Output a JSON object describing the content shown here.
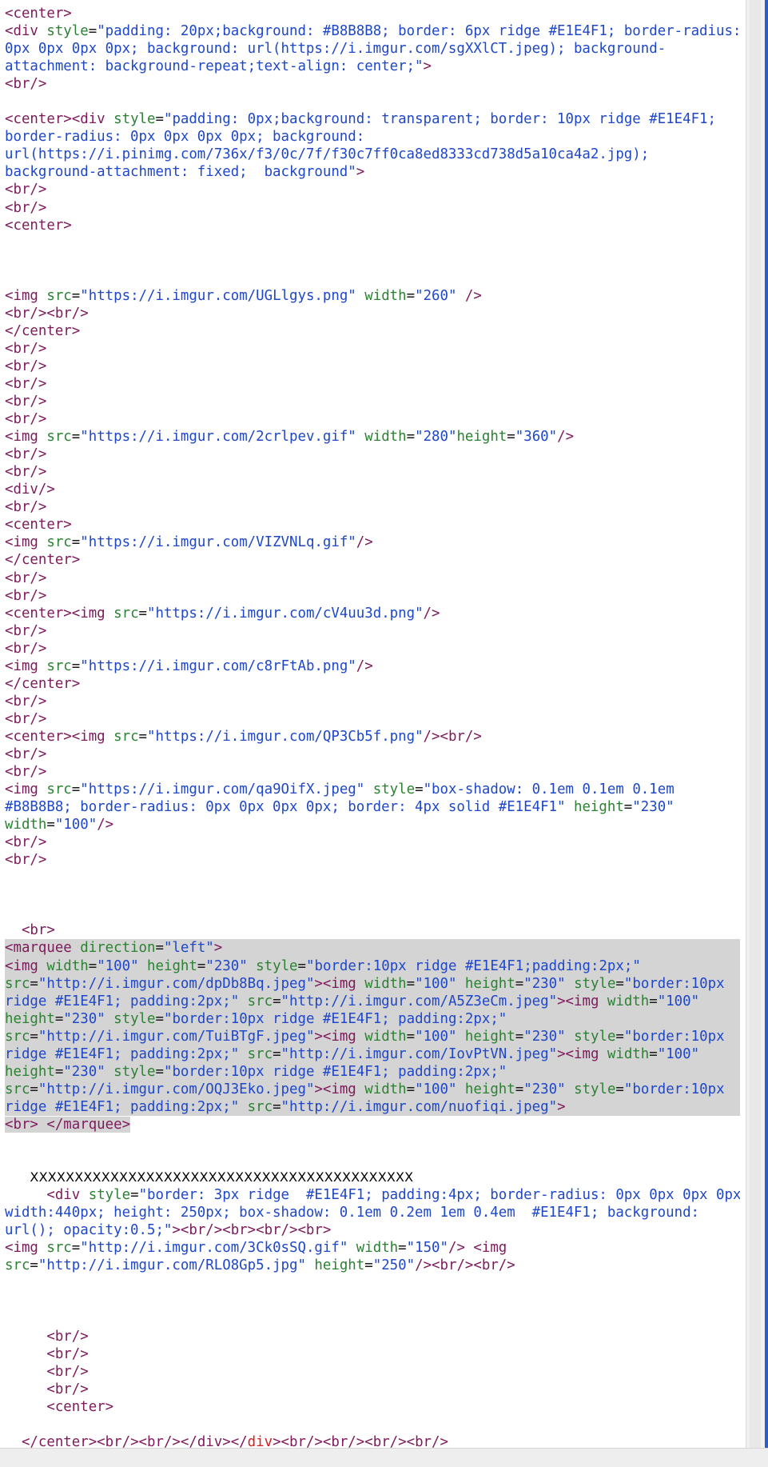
{
  "lines": [
    {
      "segs": [
        [
          "tag",
          "<center>"
        ]
      ]
    },
    {
      "segs": [
        [
          "tag",
          "<div "
        ],
        [
          "attr",
          "style"
        ],
        [
          "plain",
          "="
        ],
        [
          "val",
          "\"padding: 20px;background: #B8B8B8; border: 6px ridge #E1E4F1; border-radius:"
        ]
      ]
    },
    {
      "segs": [
        [
          "val",
          "0px 0px 0px 0px; background: url(https://i.imgur.com/sgXXlCT.jpeg); background-"
        ]
      ]
    },
    {
      "segs": [
        [
          "val",
          "attachment: background-repeat;text-align: center;\""
        ],
        [
          "tag",
          ">"
        ]
      ]
    },
    {
      "segs": [
        [
          "tag",
          "<br/>"
        ]
      ]
    },
    {
      "segs": []
    },
    {
      "segs": [
        [
          "tag",
          "<center><div "
        ],
        [
          "attr",
          "style"
        ],
        [
          "plain",
          "="
        ],
        [
          "val",
          "\"padding: 0px;background: transparent; border: 10px ridge #E1E4F1;"
        ]
      ]
    },
    {
      "segs": [
        [
          "val",
          "border-radius: 0px 0px 0px 0px; background:"
        ]
      ]
    },
    {
      "segs": [
        [
          "val",
          "url(https://i.pinimg.com/736x/f3/0c/7f/f30c7ff0ca8ed8333cd738d5a10ca4a2.jpg);"
        ]
      ]
    },
    {
      "segs": [
        [
          "val",
          "background-attachment: fixed;  background\""
        ],
        [
          "tag",
          ">"
        ]
      ]
    },
    {
      "segs": [
        [
          "tag",
          "<br/>"
        ]
      ]
    },
    {
      "segs": [
        [
          "tag",
          "<br/>"
        ]
      ]
    },
    {
      "segs": [
        [
          "tag",
          "<center>"
        ]
      ]
    },
    {
      "segs": []
    },
    {
      "segs": []
    },
    {
      "segs": []
    },
    {
      "segs": [
        [
          "tag",
          "<img "
        ],
        [
          "attr",
          "src"
        ],
        [
          "plain",
          "="
        ],
        [
          "val",
          "\"https://i.imgur.com/UGLlgys.png\" "
        ],
        [
          "attr",
          "width"
        ],
        [
          "plain",
          "="
        ],
        [
          "val",
          "\"260\" "
        ],
        [
          "tag",
          "/>"
        ]
      ]
    },
    {
      "segs": [
        [
          "tag",
          "<br/><br/>"
        ]
      ]
    },
    {
      "segs": [
        [
          "tag",
          "</center>"
        ]
      ]
    },
    {
      "segs": [
        [
          "tag",
          "<br/>"
        ]
      ]
    },
    {
      "segs": [
        [
          "tag",
          "<br/>"
        ]
      ]
    },
    {
      "segs": [
        [
          "tag",
          "<br/>"
        ]
      ]
    },
    {
      "segs": [
        [
          "tag",
          "<br/>"
        ]
      ]
    },
    {
      "segs": [
        [
          "tag",
          "<br/>"
        ]
      ]
    },
    {
      "segs": [
        [
          "tag",
          "<img "
        ],
        [
          "attr",
          "src"
        ],
        [
          "plain",
          "="
        ],
        [
          "val",
          "\"https://i.imgur.com/2crlpev.gif\" "
        ],
        [
          "attr",
          "width"
        ],
        [
          "plain",
          "="
        ],
        [
          "val",
          "\"280\""
        ],
        [
          "attr",
          "height"
        ],
        [
          "plain",
          "="
        ],
        [
          "val",
          "\"360\""
        ],
        [
          "tag",
          "/>"
        ]
      ]
    },
    {
      "segs": [
        [
          "tag",
          "<br/>"
        ]
      ]
    },
    {
      "segs": [
        [
          "tag",
          "<br/>"
        ]
      ]
    },
    {
      "segs": [
        [
          "tag",
          "<div/>"
        ]
      ]
    },
    {
      "segs": [
        [
          "tag",
          "<br/>"
        ]
      ]
    },
    {
      "segs": [
        [
          "tag",
          "<center>"
        ]
      ]
    },
    {
      "segs": [
        [
          "tag",
          "<img "
        ],
        [
          "attr",
          "src"
        ],
        [
          "plain",
          "="
        ],
        [
          "val",
          "\"https://i.imgur.com/VIZVNLq.gif\""
        ],
        [
          "tag",
          "/>"
        ]
      ]
    },
    {
      "segs": [
        [
          "tag",
          "</center>"
        ]
      ]
    },
    {
      "segs": [
        [
          "tag",
          "<br/>"
        ]
      ]
    },
    {
      "segs": [
        [
          "tag",
          "<br/>"
        ]
      ]
    },
    {
      "segs": [
        [
          "tag",
          "<center><img "
        ],
        [
          "attr",
          "src"
        ],
        [
          "plain",
          "="
        ],
        [
          "val",
          "\"https://i.imgur.com/cV4uu3d.png\""
        ],
        [
          "tag",
          "/>"
        ]
      ]
    },
    {
      "segs": [
        [
          "tag",
          "<br/>"
        ]
      ]
    },
    {
      "segs": [
        [
          "tag",
          "<br/>"
        ]
      ]
    },
    {
      "segs": [
        [
          "tag",
          "<img "
        ],
        [
          "attr",
          "src"
        ],
        [
          "plain",
          "="
        ],
        [
          "val",
          "\"https://i.imgur.com/c8rFtAb.png\""
        ],
        [
          "tag",
          "/>"
        ]
      ]
    },
    {
      "segs": [
        [
          "tag",
          "</center>"
        ]
      ]
    },
    {
      "segs": [
        [
          "tag",
          "<br/>"
        ]
      ]
    },
    {
      "segs": [
        [
          "tag",
          "<br/>"
        ]
      ]
    },
    {
      "segs": [
        [
          "tag",
          "<center><img "
        ],
        [
          "attr",
          "src"
        ],
        [
          "plain",
          "="
        ],
        [
          "val",
          "\"https://i.imgur.com/QP3Cb5f.png\""
        ],
        [
          "tag",
          "/><br/>"
        ]
      ]
    },
    {
      "segs": [
        [
          "tag",
          "<br/>"
        ]
      ]
    },
    {
      "segs": [
        [
          "tag",
          "<br/>"
        ]
      ]
    },
    {
      "segs": [
        [
          "tag",
          "<img "
        ],
        [
          "attr",
          "src"
        ],
        [
          "plain",
          "="
        ],
        [
          "val",
          "\"https://i.imgur.com/qa9OifX.jpeg\" "
        ],
        [
          "attr",
          "style"
        ],
        [
          "plain",
          "="
        ],
        [
          "val",
          "\"box-shadow: 0.1em 0.1em 0.1em"
        ]
      ]
    },
    {
      "segs": [
        [
          "val",
          "#B8B8B8; border-radius: 0px 0px 0px 0px; border: 4px solid #E1E4F1\" "
        ],
        [
          "attr",
          "height"
        ],
        [
          "plain",
          "="
        ],
        [
          "val",
          "\"230\""
        ]
      ]
    },
    {
      "segs": [
        [
          "attr",
          "width"
        ],
        [
          "plain",
          "="
        ],
        [
          "val",
          "\"100\""
        ],
        [
          "tag",
          "/>"
        ]
      ]
    },
    {
      "segs": [
        [
          "tag",
          "<br/>"
        ]
      ]
    },
    {
      "segs": [
        [
          "tag",
          "<br/>"
        ]
      ]
    },
    {
      "segs": []
    },
    {
      "segs": []
    },
    {
      "segs": []
    },
    {
      "segs": [
        [
          "plain",
          "  "
        ],
        [
          "tag",
          "<br>"
        ]
      ]
    },
    {
      "sel": true,
      "segs": [
        [
          "tag",
          "<marquee "
        ],
        [
          "attr",
          "direction"
        ],
        [
          "plain",
          "="
        ],
        [
          "val",
          "\"left\""
        ],
        [
          "tag",
          ">"
        ]
      ]
    },
    {
      "sel": true,
      "segs": [
        [
          "tag",
          "<img "
        ],
        [
          "attr",
          "width"
        ],
        [
          "plain",
          "="
        ],
        [
          "val",
          "\"100\" "
        ],
        [
          "attr",
          "height"
        ],
        [
          "plain",
          "="
        ],
        [
          "val",
          "\"230\" "
        ],
        [
          "attr",
          "style"
        ],
        [
          "plain",
          "="
        ],
        [
          "val",
          "\"border:10px ridge #E1E4F1;padding:2px;\""
        ]
      ]
    },
    {
      "sel": true,
      "segs": [
        [
          "attr",
          "src"
        ],
        [
          "plain",
          "="
        ],
        [
          "val",
          "\"http://i.imgur.com/dpDb8Bq.jpeg\""
        ],
        [
          "tag",
          "><img "
        ],
        [
          "attr",
          "width"
        ],
        [
          "plain",
          "="
        ],
        [
          "val",
          "\"100\" "
        ],
        [
          "attr",
          "height"
        ],
        [
          "plain",
          "="
        ],
        [
          "val",
          "\"230\" "
        ],
        [
          "attr",
          "style"
        ],
        [
          "plain",
          "="
        ],
        [
          "val",
          "\"border:10px"
        ]
      ]
    },
    {
      "sel": true,
      "segs": [
        [
          "val",
          "ridge #E1E4F1; padding:2px;\" "
        ],
        [
          "attr",
          "src"
        ],
        [
          "plain",
          "="
        ],
        [
          "val",
          "\"http://i.imgur.com/A5Z3eCm.jpeg\""
        ],
        [
          "tag",
          "><img "
        ],
        [
          "attr",
          "width"
        ],
        [
          "plain",
          "="
        ],
        [
          "val",
          "\"100\""
        ]
      ]
    },
    {
      "sel": true,
      "segs": [
        [
          "attr",
          "height"
        ],
        [
          "plain",
          "="
        ],
        [
          "val",
          "\"230\" "
        ],
        [
          "attr",
          "style"
        ],
        [
          "plain",
          "="
        ],
        [
          "val",
          "\"border:10px ridge #E1E4F1; padding:2px;\""
        ]
      ]
    },
    {
      "sel": true,
      "segs": [
        [
          "attr",
          "src"
        ],
        [
          "plain",
          "="
        ],
        [
          "val",
          "\"http://i.imgur.com/TuiBTgF.jpeg\""
        ],
        [
          "tag",
          "><img "
        ],
        [
          "attr",
          "width"
        ],
        [
          "plain",
          "="
        ],
        [
          "val",
          "\"100\" "
        ],
        [
          "attr",
          "height"
        ],
        [
          "plain",
          "="
        ],
        [
          "val",
          "\"230\" "
        ],
        [
          "attr",
          "style"
        ],
        [
          "plain",
          "="
        ],
        [
          "val",
          "\"border:10px"
        ]
      ]
    },
    {
      "sel": true,
      "segs": [
        [
          "val",
          "ridge #E1E4F1; padding:2px;\" "
        ],
        [
          "attr",
          "src"
        ],
        [
          "plain",
          "="
        ],
        [
          "val",
          "\"http://i.imgur.com/IovPtVN.jpeg\""
        ],
        [
          "tag",
          "><img "
        ],
        [
          "attr",
          "width"
        ],
        [
          "plain",
          "="
        ],
        [
          "val",
          "\"100\""
        ]
      ]
    },
    {
      "sel": true,
      "segs": [
        [
          "attr",
          "height"
        ],
        [
          "plain",
          "="
        ],
        [
          "val",
          "\"230\" "
        ],
        [
          "attr",
          "style"
        ],
        [
          "plain",
          "="
        ],
        [
          "val",
          "\"border:10px ridge #E1E4F1; padding:2px;\""
        ]
      ]
    },
    {
      "sel": true,
      "segs": [
        [
          "attr",
          "src"
        ],
        [
          "plain",
          "="
        ],
        [
          "val",
          "\"http://i.imgur.com/OQJ3Eko.jpeg\""
        ],
        [
          "tag",
          "><img "
        ],
        [
          "attr",
          "width"
        ],
        [
          "plain",
          "="
        ],
        [
          "val",
          "\"100\" "
        ],
        [
          "attr",
          "height"
        ],
        [
          "plain",
          "="
        ],
        [
          "val",
          "\"230\" "
        ],
        [
          "attr",
          "style"
        ],
        [
          "plain",
          "="
        ],
        [
          "val",
          "\"border:10px"
        ]
      ]
    },
    {
      "sel": true,
      "segs": [
        [
          "val",
          "ridge #E1E4F1; padding:2px;\" "
        ],
        [
          "attr",
          "src"
        ],
        [
          "plain",
          "="
        ],
        [
          "val",
          "\"http://i.imgur.com/nuofiqi.jpeg\""
        ],
        [
          "tag",
          ">"
        ]
      ]
    },
    {
      "sel": "partial",
      "segs": [
        [
          "tag",
          "<br> </marquee>"
        ]
      ]
    },
    {
      "segs": []
    },
    {
      "segs": []
    },
    {
      "x": true,
      "segs": [
        [
          "plain",
          "   "
        ],
        [
          "xline",
          "XXXXXXXXXXXXXXXXXXXXXXXXXXXXXXXXXXXXXXXXXXX"
        ]
      ]
    },
    {
      "segs": [
        [
          "plain",
          "     "
        ],
        [
          "tag",
          "<div "
        ],
        [
          "attr",
          "style"
        ],
        [
          "plain",
          "="
        ],
        [
          "val",
          "\"border: 3px ridge  #E1E4F1; padding:4px; border-radius: 0px 0px 0px 0px;"
        ]
      ]
    },
    {
      "segs": [
        [
          "val",
          "width:440px; height: 250px; box-shadow: 0.1em 0.2em 1em 0.4em  #E1E4F1; background:"
        ]
      ]
    },
    {
      "segs": [
        [
          "val",
          "url(); opacity:0.5;\""
        ],
        [
          "tag",
          "><br/><br><br/><br>"
        ]
      ]
    },
    {
      "segs": [
        [
          "tag",
          "<img "
        ],
        [
          "attr",
          "src"
        ],
        [
          "plain",
          "="
        ],
        [
          "val",
          "\"http://i.imgur.com/3Ck0sSQ.gif\" "
        ],
        [
          "attr",
          "width"
        ],
        [
          "plain",
          "="
        ],
        [
          "val",
          "\"150\""
        ],
        [
          "tag",
          "/> <img"
        ]
      ]
    },
    {
      "segs": [
        [
          "attr",
          "src"
        ],
        [
          "plain",
          "="
        ],
        [
          "val",
          "\"http://i.imgur.com/RLO8Gp5.jpg\" "
        ],
        [
          "attr",
          "height"
        ],
        [
          "plain",
          "="
        ],
        [
          "val",
          "\"250\""
        ],
        [
          "tag",
          "/><br/><br/>"
        ]
      ]
    },
    {
      "segs": []
    },
    {
      "segs": []
    },
    {
      "segs": []
    },
    {
      "segs": [
        [
          "plain",
          "     "
        ],
        [
          "tag",
          "<br/>"
        ]
      ]
    },
    {
      "segs": [
        [
          "plain",
          "     "
        ],
        [
          "tag",
          "<br/>"
        ]
      ]
    },
    {
      "segs": [
        [
          "plain",
          "     "
        ],
        [
          "tag",
          "<br/>"
        ]
      ]
    },
    {
      "segs": [
        [
          "plain",
          "     "
        ],
        [
          "tag",
          "<br/>"
        ]
      ]
    },
    {
      "segs": [
        [
          "plain",
          "     "
        ],
        [
          "tag",
          "<center>"
        ]
      ]
    },
    {
      "segs": []
    },
    {
      "segs": [
        [
          "plain",
          "  "
        ],
        [
          "tag",
          "</center><br/><br/></div></"
        ],
        [
          "tag-red",
          "div"
        ],
        [
          "tag",
          "><br/><br/><br/><br/>"
        ]
      ]
    }
  ],
  "colors": {
    "tag": "#7e1a5b",
    "attr": "#2b8232",
    "value": "#1f47c9",
    "selection": "#d4d4d4",
    "scrollbar_accent": "#2b5cc8"
  }
}
